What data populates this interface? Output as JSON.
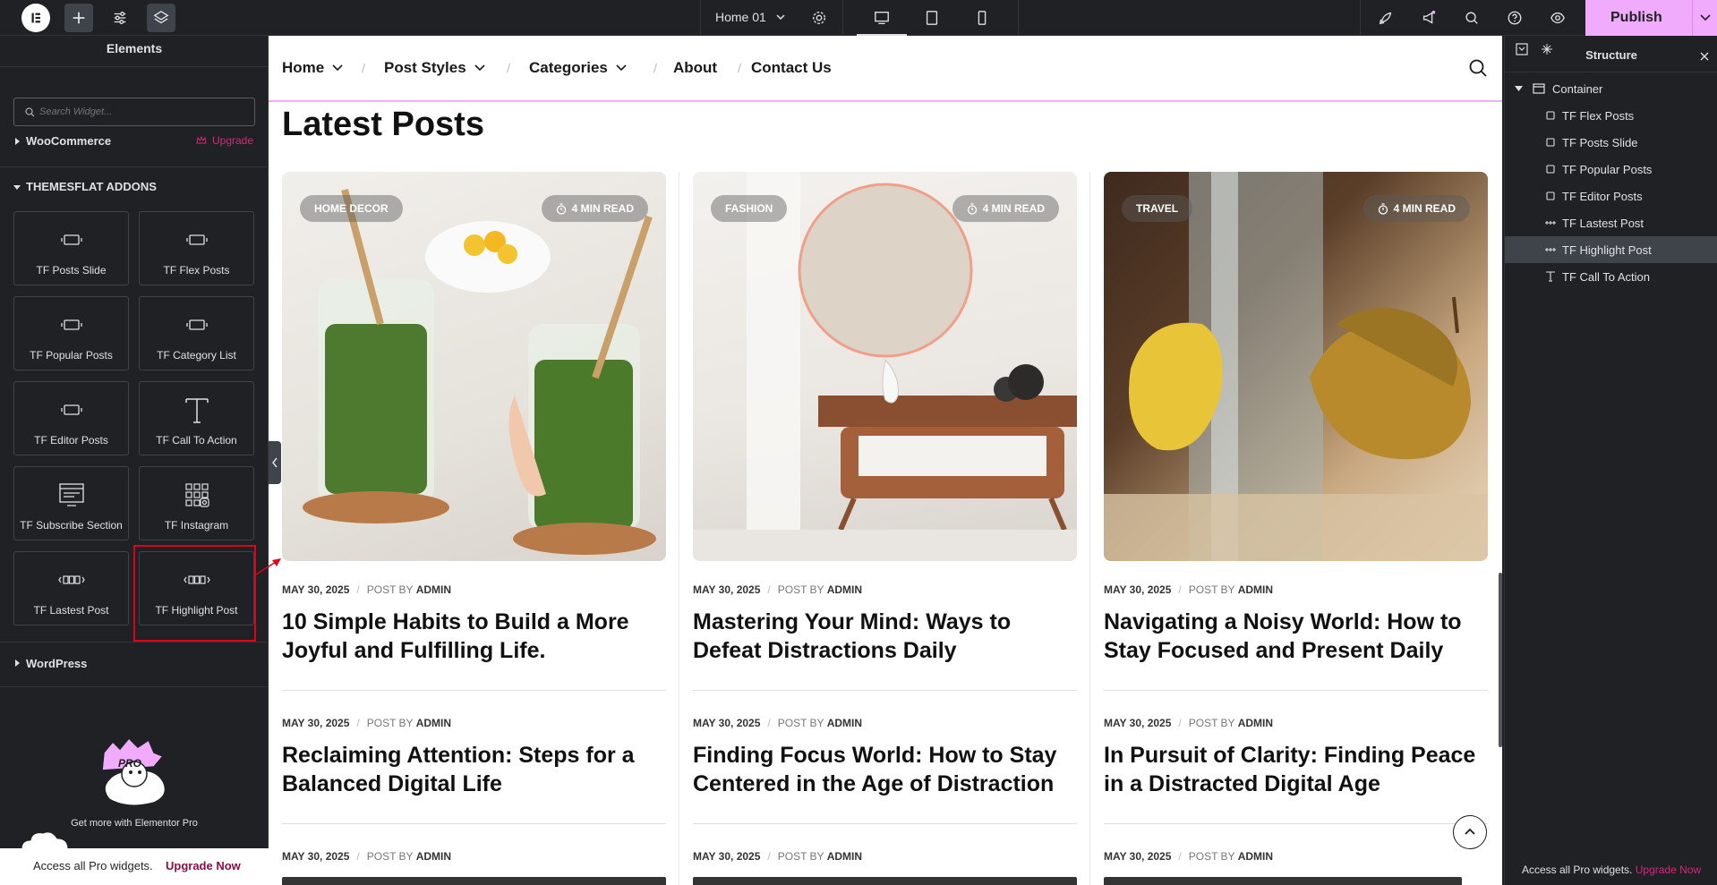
{
  "topbar": {
    "page_name": "Home 01",
    "publish_label": "Publish"
  },
  "left_panel": {
    "title": "Elements",
    "search_placeholder": "Search Widget...",
    "woocommerce_label": "WooCommerce",
    "upgrade_label": "Upgrade",
    "section_label": "THEMESFLAT ADDONS",
    "widgets": [
      {
        "label": "TF Posts Slide",
        "icon": "slide-icon"
      },
      {
        "label": "TF Flex Posts",
        "icon": "slide-icon"
      },
      {
        "label": "TF Popular Posts",
        "icon": "slide-icon"
      },
      {
        "label": "TF Category List",
        "icon": "slide-icon"
      },
      {
        "label": "TF Editor Posts",
        "icon": "slide-icon"
      },
      {
        "label": "TF Call To Action",
        "icon": "text-icon"
      },
      {
        "label": "TF Subscribe Section",
        "icon": "subscribe-icon"
      },
      {
        "label": "TF Instagram",
        "icon": "instagram-grid-icon"
      },
      {
        "label": "TF Lastest Post",
        "icon": "post-carousel-icon"
      },
      {
        "label": "TF Highlight Post",
        "icon": "post-carousel-icon"
      }
    ],
    "wordpress_label": "WordPress",
    "promo_text": "Get more with Elementor Pro",
    "promo_badge": "PRO",
    "pro_bar_text": "Access all Pro widgets.",
    "pro_bar_link": "Upgrade Now"
  },
  "nav": {
    "items": [
      {
        "label": "Home",
        "has_caret": true
      },
      {
        "label": "Post Styles",
        "has_caret": true
      },
      {
        "label": "Categories",
        "has_caret": true
      },
      {
        "label": "About",
        "has_caret": false
      },
      {
        "label": "Contact Us",
        "has_caret": false
      }
    ]
  },
  "main": {
    "heading": "Latest Posts",
    "cards": [
      {
        "category": "HOME DECOR",
        "read": "4 MIN READ"
      },
      {
        "category": "FASHION",
        "read": "4 MIN READ"
      },
      {
        "category": "TRAVEL",
        "read": "4 MIN READ"
      }
    ],
    "posts": [
      {
        "date": "MAY 30, 2025",
        "post_by": "POST BY",
        "author": "ADMIN",
        "title": "10 Simple Habits to Build a More Joyful and Fulfilling Life."
      },
      {
        "date": "MAY 30, 2025",
        "post_by": "POST BY",
        "author": "ADMIN",
        "title": "Mastering Your Mind: Ways to Defeat Distractions Daily"
      },
      {
        "date": "MAY 30, 2025",
        "post_by": "POST BY",
        "author": "ADMIN",
        "title": "Navigating a Noisy World: How to Stay Focused and Present Daily"
      },
      {
        "date": "MAY 30, 2025",
        "post_by": "POST BY",
        "author": "ADMIN",
        "title": "Reclaiming Attention: Steps for a Balanced Digital Life"
      },
      {
        "date": "MAY 30, 2025",
        "post_by": "POST BY",
        "author": "ADMIN",
        "title": "Finding Focus World: How to Stay Centered in the Age of Distraction"
      },
      {
        "date": "MAY 30, 2025",
        "post_by": "POST BY",
        "author": "ADMIN",
        "title": "In Pursuit of Clarity: Finding Peace in a Distracted Digital Age"
      },
      {
        "date": "MAY 30, 2025",
        "post_by": "POST BY",
        "author": "ADMIN",
        "title": ""
      },
      {
        "date": "MAY 30, 2025",
        "post_by": "POST BY",
        "author": "ADMIN",
        "title": ""
      },
      {
        "date": "MAY 30, 2025",
        "post_by": "POST BY",
        "author": "ADMIN",
        "title": ""
      }
    ]
  },
  "structure": {
    "title": "Structure",
    "root": "Container",
    "items": [
      {
        "label": "TF Flex Posts",
        "icon": "slide-icon"
      },
      {
        "label": "TF Posts Slide",
        "icon": "slide-icon"
      },
      {
        "label": "TF Popular Posts",
        "icon": "slide-icon"
      },
      {
        "label": "TF Editor Posts",
        "icon": "slide-icon"
      },
      {
        "label": "TF Lastest Post",
        "icon": "post-carousel-icon"
      },
      {
        "label": "TF Highlight Post",
        "icon": "post-carousel-icon"
      },
      {
        "label": "TF Call To Action",
        "icon": "text-icon"
      }
    ],
    "pro_bar_text": "Access all Pro widgets.",
    "pro_bar_link": "Upgrade Now"
  },
  "colors": {
    "accent": "#f0abfc",
    "highlight_border": "#e0001a",
    "upgrade_pink": "#d5287b",
    "panel_bg": "#1f2124"
  }
}
